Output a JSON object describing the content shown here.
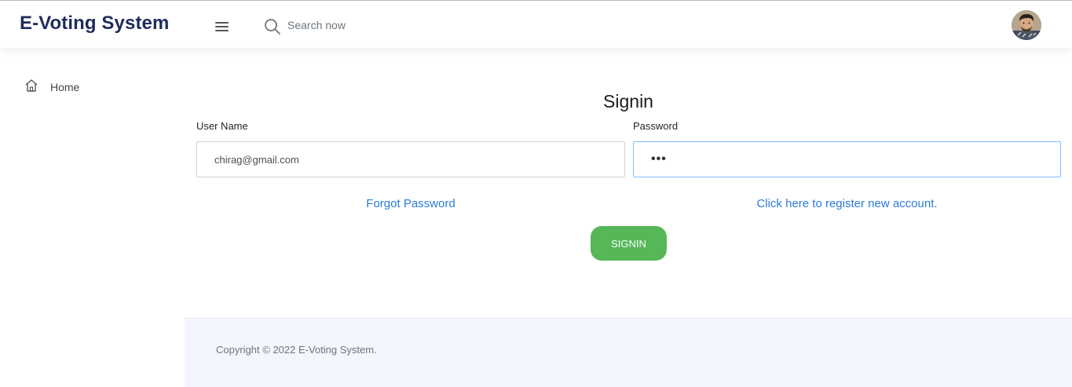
{
  "header": {
    "brand": "E-Voting System",
    "search_placeholder": "Search now",
    "menu_icon": "hamburger-icon",
    "search_icon": "search-icon",
    "avatar_icon": "user-avatar"
  },
  "sidebar": {
    "items": [
      {
        "label": "Home",
        "icon": "home-icon"
      }
    ]
  },
  "form": {
    "title": "Signin",
    "username_label": "User Name",
    "username_value": "chirag@gmail.com",
    "password_label": "Password",
    "password_masked": "•••",
    "forgot_link": "Forgot Password",
    "register_link": "Click here to register new account.",
    "submit_label": "SIGNIN"
  },
  "footer": {
    "copyright": "Copyright © 2022 E-Voting System."
  },
  "colors": {
    "brand": "#1f2b5b",
    "link": "#2b7bd6",
    "button": "#55b757",
    "footer_bg": "#f3f6fc",
    "focus_border": "#80bdff"
  }
}
